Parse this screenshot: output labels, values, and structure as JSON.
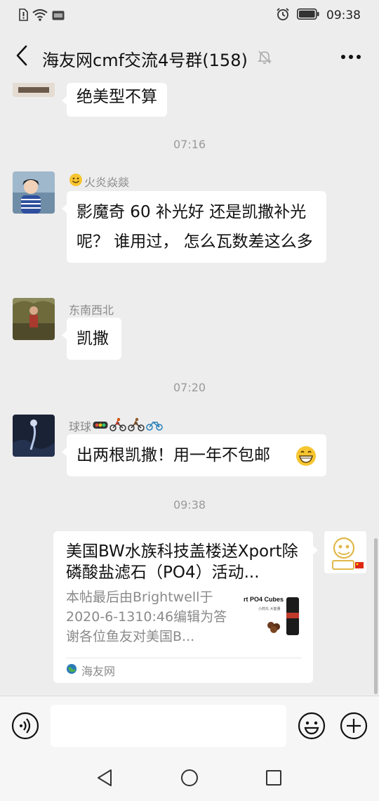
{
  "status_bar": {
    "time": "09:38",
    "icons": [
      "sim-alert-icon",
      "wifi-icon",
      "hd-icon",
      "alarm-icon",
      "battery-icon"
    ]
  },
  "header": {
    "title": "海友网cmf交流4号群(158)",
    "icons": [
      "back-arrow-icon",
      "mute-bell-icon",
      "more-dots-icon"
    ]
  },
  "messages": {
    "m0": {
      "text": "绝美型不算"
    },
    "t1": "07:16",
    "m1": {
      "sender": "火炎焱燚",
      "text": "影魔奇 60 补光好 还是凯撒补光呢？ 谁用过， 怎么瓦数差这么多"
    },
    "m2": {
      "sender": "东南西北",
      "text": "凯撒"
    },
    "t2": "07:20",
    "m3": {
      "sender": "球球",
      "text": "出两根凯撒！用一年不包邮"
    },
    "t3": "09:38",
    "card": {
      "title": "美国BW水族科技盖楼送Xport除磷酸盐滤石（PO4）活动...",
      "description": "本帖最后由Brightwell于2020-6-1310:46编辑为答谢各位鱼友对美国B...",
      "thumb_text": "rt PO4 Cubes",
      "thumb_subtext": "小药丸 大能量",
      "source": "海友网"
    }
  },
  "input_bar": {
    "placeholder": "",
    "icons": [
      "voice-icon",
      "emoji-icon",
      "plus-icon"
    ]
  },
  "nav_bar": {
    "icons": [
      "nav-back-icon",
      "nav-home-icon",
      "nav-recent-icon"
    ]
  },
  "colors": {
    "background": "#ededed",
    "bubble": "#ffffff",
    "meta_text": "#9a9a9a"
  }
}
